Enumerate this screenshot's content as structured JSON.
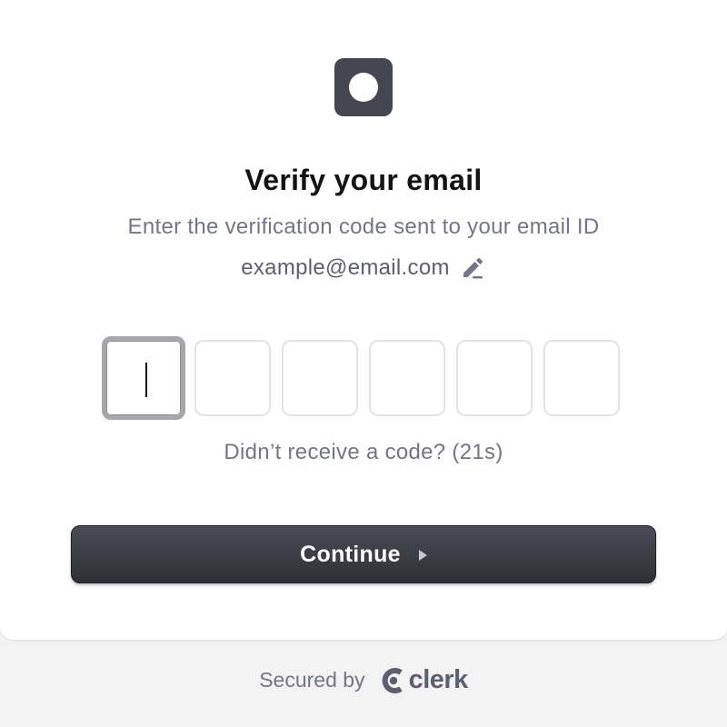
{
  "header": {
    "logo_icon": "app-logo-icon",
    "title": "Verify your email",
    "subtitle": "Enter the verification code sent to your email ID",
    "email": "example@email.com",
    "edit_icon": "pencil-icon"
  },
  "otp": {
    "digits": [
      "",
      "",
      "",
      "",
      "",
      ""
    ],
    "active_index": 0
  },
  "resend": {
    "text": "Didn’t receive a code? (21s)"
  },
  "actions": {
    "continue_label": "Continue",
    "continue_icon": "play-arrow-icon"
  },
  "footer": {
    "secured_by": "Secured by",
    "brand": "clerk",
    "brand_icon": "clerk-logo-icon"
  },
  "colors": {
    "primary_button": "#2f3037",
    "muted_text": "#747686",
    "heading": "#131316",
    "background": "#f3f3f4"
  }
}
